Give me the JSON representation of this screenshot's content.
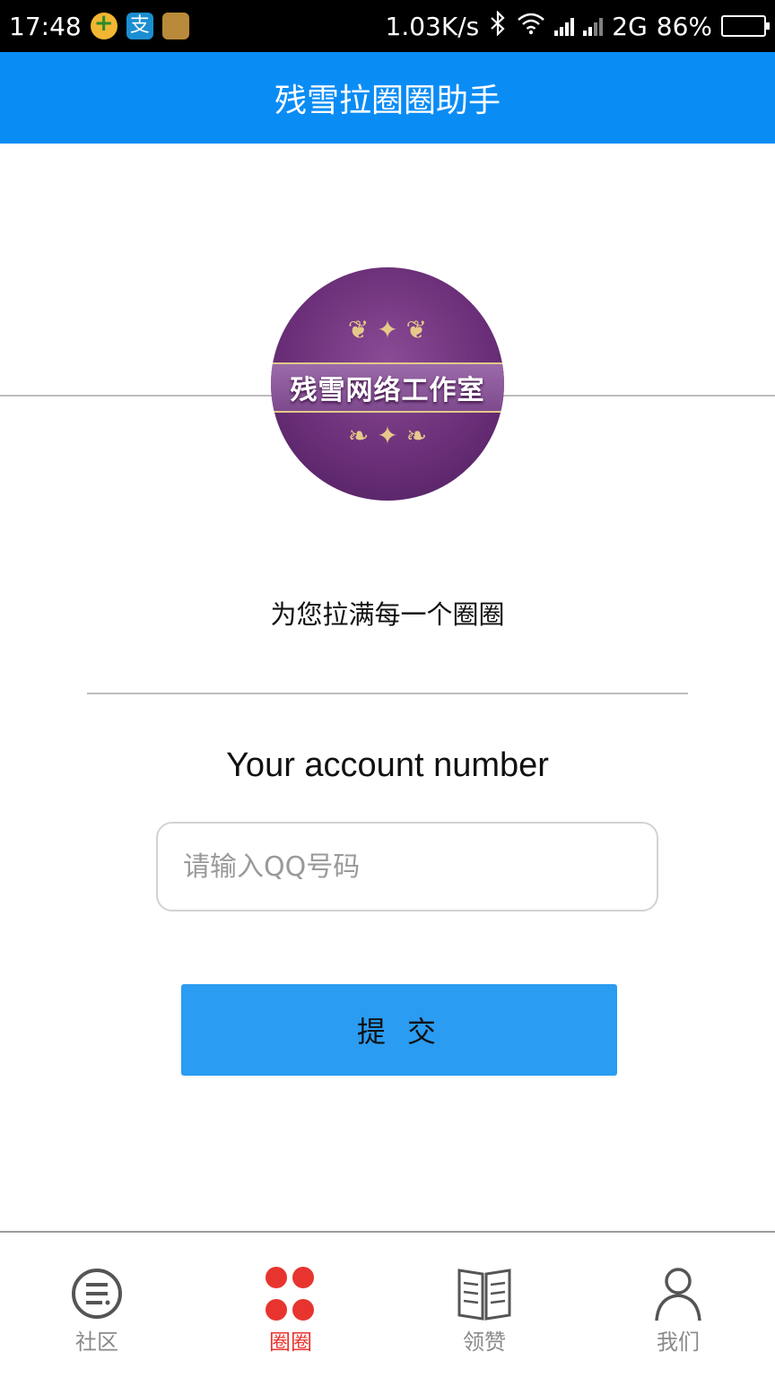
{
  "status_bar": {
    "time": "17:48",
    "network_speed": "1.03K/s",
    "network_type": "2G",
    "battery": "86%",
    "battery_level": 0.86,
    "notification_icons": [
      "plus-app-icon",
      "alipay-icon",
      "gold-app-icon"
    ],
    "alipay_glyph": "支"
  },
  "app_bar": {
    "title": "残雪拉圈圈助手"
  },
  "logo": {
    "text": "残雪网络工作室"
  },
  "main": {
    "slogan": "为您拉满每一个圈圈",
    "account_label": "Your account number",
    "qq_placeholder": "请输入QQ号码",
    "qq_value": "",
    "submit_label": "提交"
  },
  "bottom_nav": {
    "items": [
      {
        "label": "社区",
        "icon": "community-icon",
        "active": false
      },
      {
        "label": "圈圈",
        "icon": "circles-icon",
        "active": true
      },
      {
        "label": "领赞",
        "icon": "book-icon",
        "active": false
      },
      {
        "label": "我们",
        "icon": "person-icon",
        "active": false
      }
    ]
  },
  "colors": {
    "app_bar": "#0a8cf5",
    "submit_button": "#2a9cf2",
    "nav_active": "#e8342f",
    "nav_inactive": "#8a8a8a"
  }
}
